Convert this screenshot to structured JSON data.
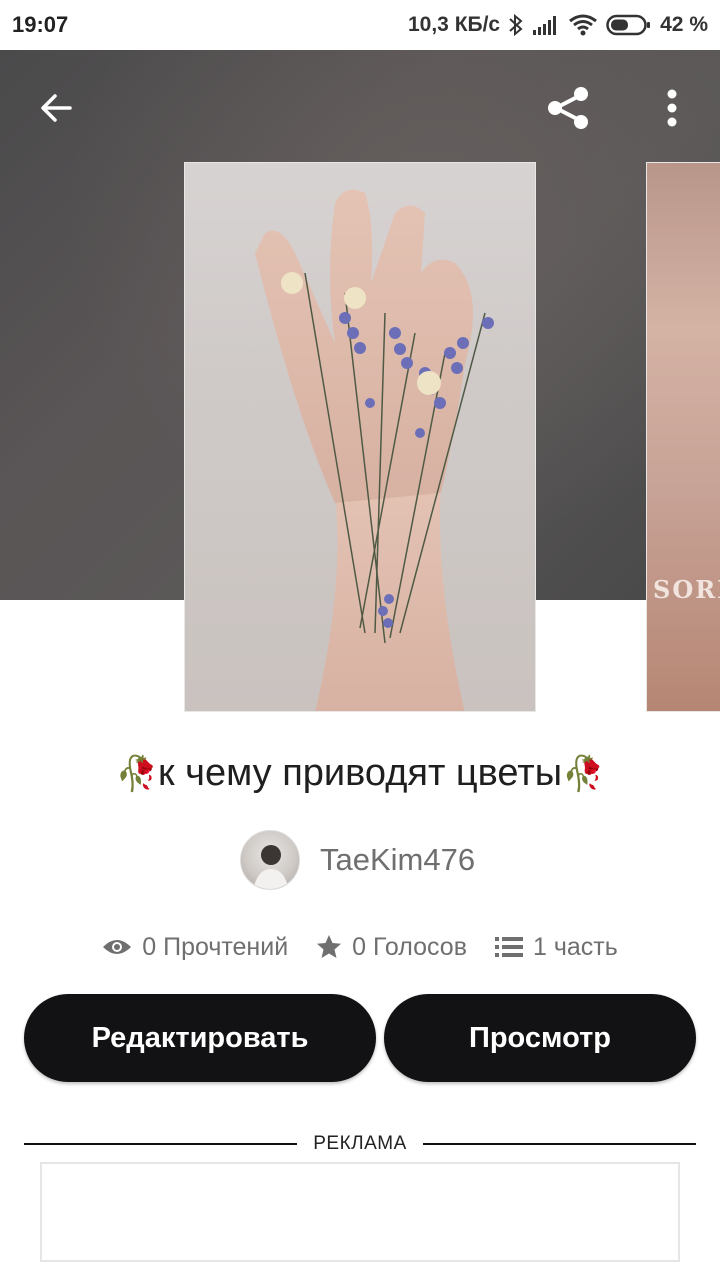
{
  "status_bar": {
    "time": "19:07",
    "network_speed": "10,3 КБ/с",
    "battery": "42 %",
    "icons": [
      "bluetooth-icon",
      "signal-icon",
      "wifi-icon",
      "battery-icon"
    ]
  },
  "top_bar": {
    "icons": [
      "back-arrow-icon",
      "share-icon",
      "more-vert-icon"
    ]
  },
  "cover_next": {
    "visible_text": "SORI"
  },
  "story": {
    "title_prefix": "🥀",
    "title": "к чему приводят цветы",
    "title_suffix": "🥀",
    "author": "TaeKim476"
  },
  "stats": {
    "reads": "0 Прочтений",
    "votes": "0 Голосов",
    "parts": "1 часть"
  },
  "buttons": {
    "edit": "Редактировать",
    "view": "Просмотр"
  },
  "ad": {
    "label": "РЕКЛАМА"
  },
  "colors": {
    "button_bg": "#121214",
    "hero_bg": "#4f4c4c",
    "accent_rose": "#b3173f"
  }
}
